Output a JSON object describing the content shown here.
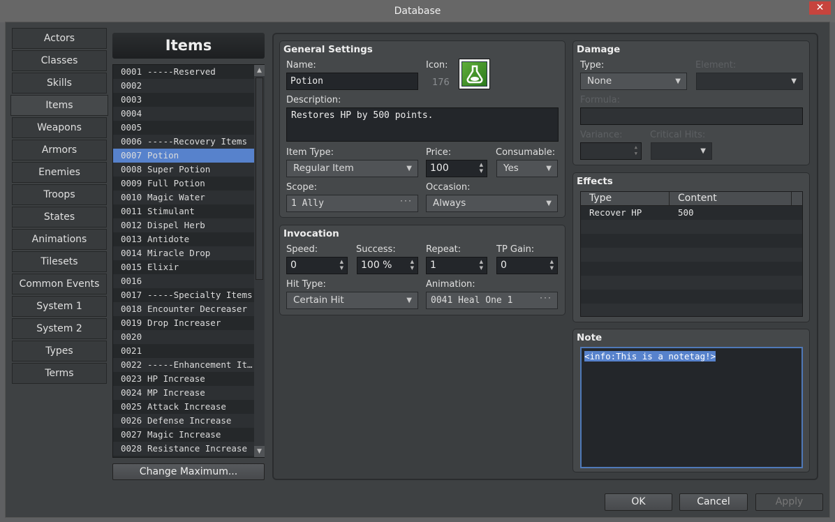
{
  "window": {
    "title": "Database",
    "close": "✕"
  },
  "tabs": [
    "Actors",
    "Classes",
    "Skills",
    "Items",
    "Weapons",
    "Armors",
    "Enemies",
    "Troops",
    "States",
    "Animations",
    "Tilesets",
    "Common Events",
    "System 1",
    "System 2",
    "Types",
    "Terms"
  ],
  "selected_tab": "Items",
  "list": {
    "title": "Items",
    "items": [
      [
        "0001",
        "-----Reserved"
      ],
      [
        "0002",
        ""
      ],
      [
        "0003",
        ""
      ],
      [
        "0004",
        ""
      ],
      [
        "0005",
        ""
      ],
      [
        "0006",
        "-----Recovery Items"
      ],
      [
        "0007",
        "Potion"
      ],
      [
        "0008",
        "Super Potion"
      ],
      [
        "0009",
        "Full Potion"
      ],
      [
        "0010",
        "Magic Water"
      ],
      [
        "0011",
        "Stimulant"
      ],
      [
        "0012",
        "Dispel Herb"
      ],
      [
        "0013",
        "Antidote"
      ],
      [
        "0014",
        "Miracle Drop"
      ],
      [
        "0015",
        "Elixir"
      ],
      [
        "0016",
        ""
      ],
      [
        "0017",
        "-----Specialty Items"
      ],
      [
        "0018",
        "Encounter Decreaser"
      ],
      [
        "0019",
        "Drop Increaser"
      ],
      [
        "0020",
        ""
      ],
      [
        "0021",
        ""
      ],
      [
        "0022",
        "-----Enhancement It…"
      ],
      [
        "0023",
        "HP Increase"
      ],
      [
        "0024",
        "MP Increase"
      ],
      [
        "0025",
        "Attack Increase"
      ],
      [
        "0026",
        "Defense Increase"
      ],
      [
        "0027",
        "Magic Increase"
      ],
      [
        "0028",
        "Resistance Increase"
      ]
    ],
    "selected": "0007",
    "change_max": "Change Maximum..."
  },
  "general": {
    "title": "General Settings",
    "name_label": "Name:",
    "name": "Potion",
    "icon_label": "Icon:",
    "icon_index": "176",
    "desc_label": "Description:",
    "description": "Restores HP by 500 points.",
    "item_type_label": "Item Type:",
    "item_type": "Regular Item",
    "price_label": "Price:",
    "price": "100",
    "consumable_label": "Consumable:",
    "consumable": "Yes",
    "scope_label": "Scope:",
    "scope": "1 Ally",
    "occasion_label": "Occasion:",
    "occasion": "Always"
  },
  "invocation": {
    "title": "Invocation",
    "speed_label": "Speed:",
    "speed": "0",
    "success_label": "Success:",
    "success": "100 %",
    "repeat_label": "Repeat:",
    "repeat": "1",
    "tp_label": "TP Gain:",
    "tp": "0",
    "hit_label": "Hit Type:",
    "hit": "Certain Hit",
    "anim_label": "Animation:",
    "anim": "0041 Heal One 1"
  },
  "damage": {
    "title": "Damage",
    "type_label": "Type:",
    "type": "None",
    "element_label": "Element:",
    "formula_label": "Formula:",
    "variance_label": "Variance:",
    "critical_label": "Critical Hits:"
  },
  "effects": {
    "title": "Effects",
    "headers": [
      "Type",
      "Content"
    ],
    "rows": [
      [
        "Recover HP",
        "500"
      ]
    ]
  },
  "note": {
    "title": "Note",
    "text": "<info:This is a notetag!>"
  },
  "buttons": {
    "ok": "OK",
    "cancel": "Cancel",
    "apply": "Apply"
  }
}
